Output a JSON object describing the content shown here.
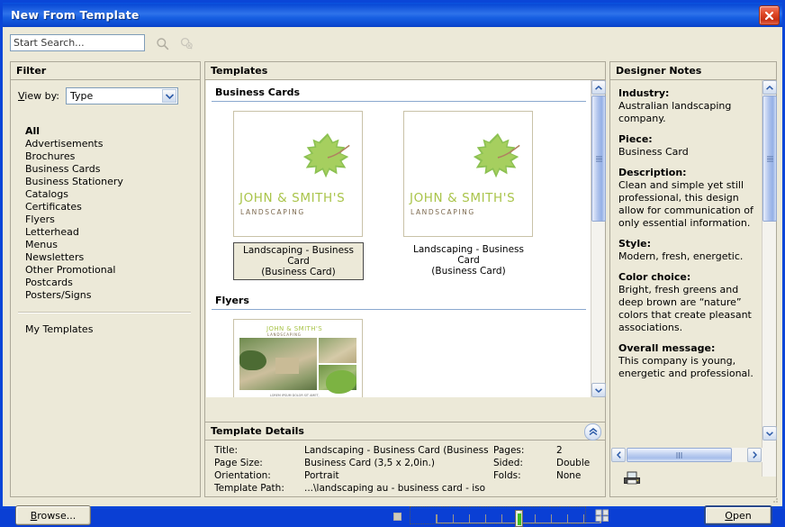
{
  "window": {
    "title": "New From Template",
    "close_icon": "close-icon"
  },
  "search": {
    "value": "Start Search...",
    "placeholder": "Start Search...",
    "search_icon": "search-icon",
    "clear_search_icon": "clear-search-icon"
  },
  "filter": {
    "header": "Filter",
    "view_by_label": "View by:",
    "view_by_value": "Type",
    "items": [
      {
        "label": "All",
        "selected": true
      },
      {
        "label": "Advertisements",
        "selected": false
      },
      {
        "label": "Brochures",
        "selected": false
      },
      {
        "label": "Business Cards",
        "selected": false
      },
      {
        "label": "Business Stationery",
        "selected": false
      },
      {
        "label": "Catalogs",
        "selected": false
      },
      {
        "label": "Certificates",
        "selected": false
      },
      {
        "label": "Flyers",
        "selected": false
      },
      {
        "label": "Letterhead",
        "selected": false
      },
      {
        "label": "Menus",
        "selected": false
      },
      {
        "label": "Newsletters",
        "selected": false
      },
      {
        "label": "Other Promotional",
        "selected": false
      },
      {
        "label": "Postcards",
        "selected": false
      },
      {
        "label": "Posters/Signs",
        "selected": false
      }
    ],
    "my_templates": "My Templates"
  },
  "templates": {
    "header": "Templates",
    "sections": [
      {
        "title": "Business Cards",
        "items": [
          {
            "caption_line1": "Landscaping - Business Card",
            "caption_line2": "(Business Card)",
            "selected": true,
            "brand": "JOHN & SMITH'S",
            "subbrand": "LANDSCAPING"
          },
          {
            "caption_line1": "Landscaping - Business Card",
            "caption_line2": "(Business Card)",
            "selected": false,
            "brand": "JOHN & SMITH'S",
            "subbrand": "LANDSCAPING"
          }
        ]
      },
      {
        "title": "Flyers",
        "items": [
          {
            "caption_line1": "",
            "caption_line2": "",
            "selected": false,
            "brand": "JOHN & SMITH'S",
            "subbrand": "LANDSCAPING"
          }
        ]
      }
    ]
  },
  "details": {
    "header": "Template Details",
    "rows_left": [
      {
        "label": "Title:",
        "value": "Landscaping - Business Card (Business"
      },
      {
        "label": "Page Size:",
        "value": "Business Card (3,5 x 2,0in.)"
      },
      {
        "label": "Orientation:",
        "value": "Portrait"
      },
      {
        "label": "Template Path:",
        "value": "...\\landscaping au - business card - iso"
      }
    ],
    "rows_right": [
      {
        "label": "Pages:",
        "value": "2"
      },
      {
        "label": "Sided:",
        "value": "Double"
      },
      {
        "label": "Folds:",
        "value": "None"
      }
    ],
    "collapse_icon": "chevron-double-up-icon"
  },
  "notes": {
    "header": "Designer Notes",
    "entries": [
      {
        "heading": "Industry:",
        "text": "Australian landscaping company."
      },
      {
        "heading": "Piece:",
        "text": "Business Card"
      },
      {
        "heading": "Description:",
        "text": "Clean and simple yet still professional, this design allow for communication of only essential information."
      },
      {
        "heading": "Style:",
        "text": "Modern, fresh, energetic."
      },
      {
        "heading": "Color choice:",
        "text": "Bright, fresh greens and deep brown are “nature” colors that create pleasant associations."
      },
      {
        "heading": "Overall message:",
        "text": "This company is young, energetic and professional."
      }
    ],
    "print_icon": "printer-icon"
  },
  "footer": {
    "browse_label": "Browse...",
    "browse_accel": "B",
    "open_label": "Open",
    "open_accel": "O",
    "grid_view_icon": "grid-view-icon",
    "zoom_slider_value": 50
  },
  "colors": {
    "titlebar_blue": "#0a46d8",
    "dialog_face": "#ece9d8",
    "brand_green": "#a9c44a",
    "brand_brown": "#7d6a4f",
    "leaf_green": "#7cb342",
    "section_rule": "#8aa9cf"
  }
}
